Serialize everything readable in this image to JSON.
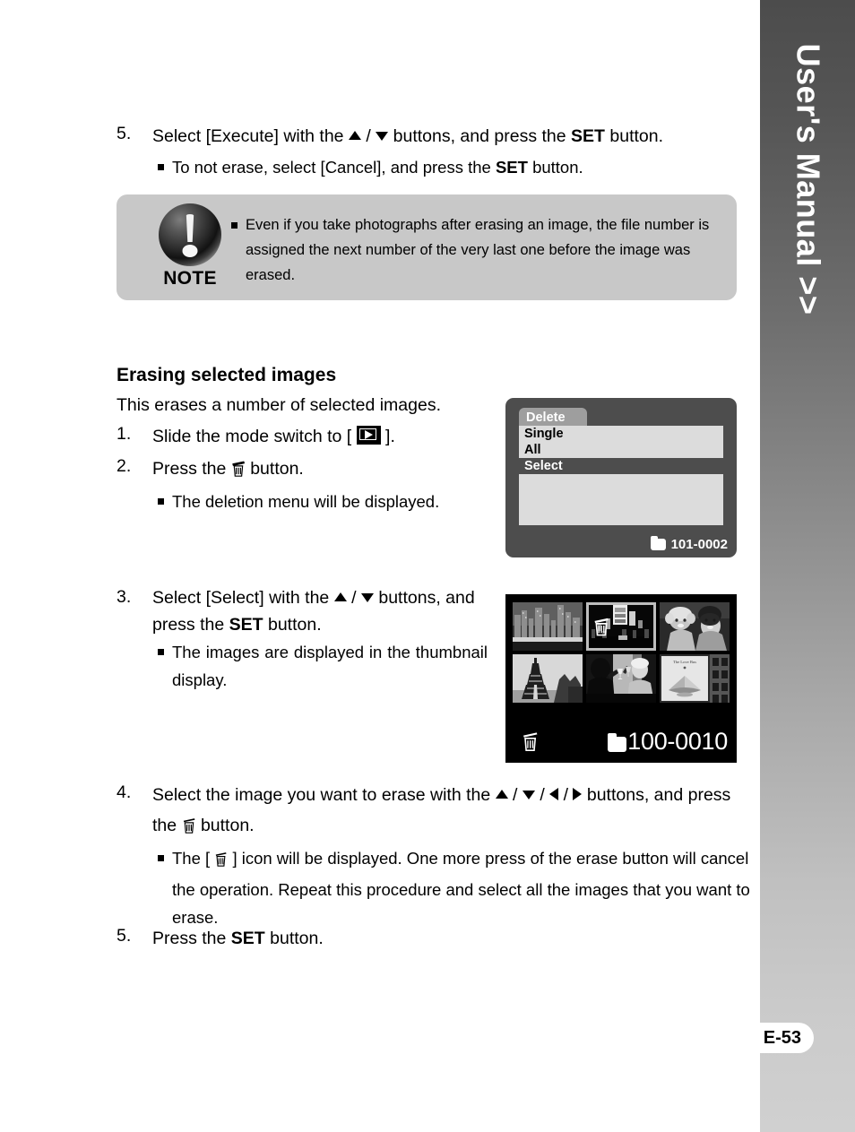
{
  "sidebar": {
    "title": "User's Manual >>",
    "page_number": "E-53"
  },
  "top_step": {
    "number": "5.",
    "text_a": "Select [Execute] with the ",
    "text_b": " / ",
    "text_c": " buttons, and press the ",
    "set_label": "SET",
    "text_d": " button.",
    "bullet_a": "To not erase, select [Cancel], and press the ",
    "bullet_set": "SET",
    "bullet_b": " button."
  },
  "note": {
    "label": "NOTE",
    "text": "Even if you take photographs after erasing an image, the file number is assigned the next number of the very last one before the image was erased."
  },
  "section": {
    "heading": "Erasing selected images",
    "intro": "This erases a number of selected images."
  },
  "steps": [
    {
      "number": "1.",
      "text_a": "Slide the mode switch to [ ",
      "text_b": " ]."
    },
    {
      "number": "2.",
      "text_a": "Press the ",
      "text_b": " button.",
      "bullet": "The deletion menu will be displayed."
    },
    {
      "number": "3.",
      "text_a": "Select [Select] with the ",
      "text_b": " / ",
      "text_c": " buttons, and press the ",
      "set_label": "SET",
      "text_d": " button.",
      "bullet": "The images are displayed in the thumbnail display."
    },
    {
      "number": "4.",
      "text_a": "Select the image you want to erase with the ",
      "text_b": " / ",
      "text_c": " / ",
      "text_d": " / ",
      "text_e": " buttons, and press the ",
      "text_f": " button.",
      "bullet_a": "The [ ",
      "bullet_b": " ] icon will be displayed. One more press of the erase button will cancel the operation. Repeat this procedure and select all the images that you want to erase."
    },
    {
      "number": "5.",
      "text_a": "Press the ",
      "set_label": "SET",
      "text_b": " button."
    }
  ],
  "lcd_menu": {
    "tab_label": "Delete",
    "items": [
      {
        "label": "Single",
        "selected": false
      },
      {
        "label": "All",
        "selected": false
      },
      {
        "label": "Select",
        "selected": true
      }
    ],
    "file_number": "101-0002",
    "folder_icon": "folder-icon"
  },
  "lcd_thumbnails": {
    "file_number": "100-0010",
    "folder_icon": "folder-icon",
    "trash_icon": "trash-icon",
    "selected_index": 1,
    "thumbs": [
      {
        "caption": "city-skyline"
      },
      {
        "caption": "night-street-signs"
      },
      {
        "caption": "child-and-man-portrait"
      },
      {
        "caption": "eiffel-tower"
      },
      {
        "caption": "couple-toasting"
      },
      {
        "caption": "book-on-table"
      }
    ]
  },
  "colors": {
    "note_bg": "#c8c8c8",
    "lcd_bg": "#4d4d4d",
    "lcd_menu_body": "#dcdcdc",
    "lcd_highlight": "#4d4d4d",
    "thumb_bg": "#000000",
    "sidebar_top": "#4c4c4c",
    "sidebar_bottom": "#d0d0d0"
  }
}
